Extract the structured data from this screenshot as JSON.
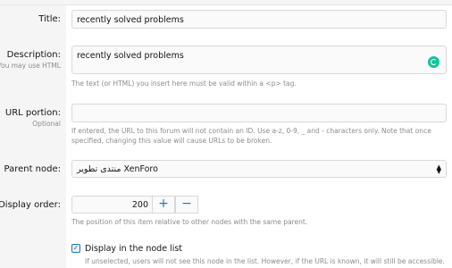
{
  "fields": {
    "title": {
      "label": "Title:",
      "value": "recently solved problems"
    },
    "description": {
      "label": "Description:",
      "sublabel": "You may use HTML",
      "value": "recently solved problems",
      "hint": "The text (or HTML) you insert here must be valid within a <p> tag."
    },
    "url_portion": {
      "label": "URL portion:",
      "sublabel": "Optional",
      "value": "",
      "hint": "If entered, the URL to this forum will not contain an ID. Use a-z, 0-9, _ and - characters only. Note that once specified, changing this value will cause URLs to be broken."
    },
    "parent_node": {
      "label": "Parent node:",
      "value": "منتدى تطوير XenForo"
    },
    "display_order": {
      "label": "Display order:",
      "value": "200",
      "plus": "+",
      "minus": "−",
      "hint": "The position of this item relative to other nodes with the same parent."
    },
    "display_in_list": {
      "label": "Display in the node list",
      "checked": true,
      "hint": "If unselected, users will not see this node in the list. However, if the URL is known, it will still be accessible."
    }
  },
  "colors": {
    "accent": "#2577b1",
    "grammarly": "#15c39a"
  },
  "icons": {
    "select": "chevron-updown-icon",
    "checkbox": "check-icon"
  }
}
